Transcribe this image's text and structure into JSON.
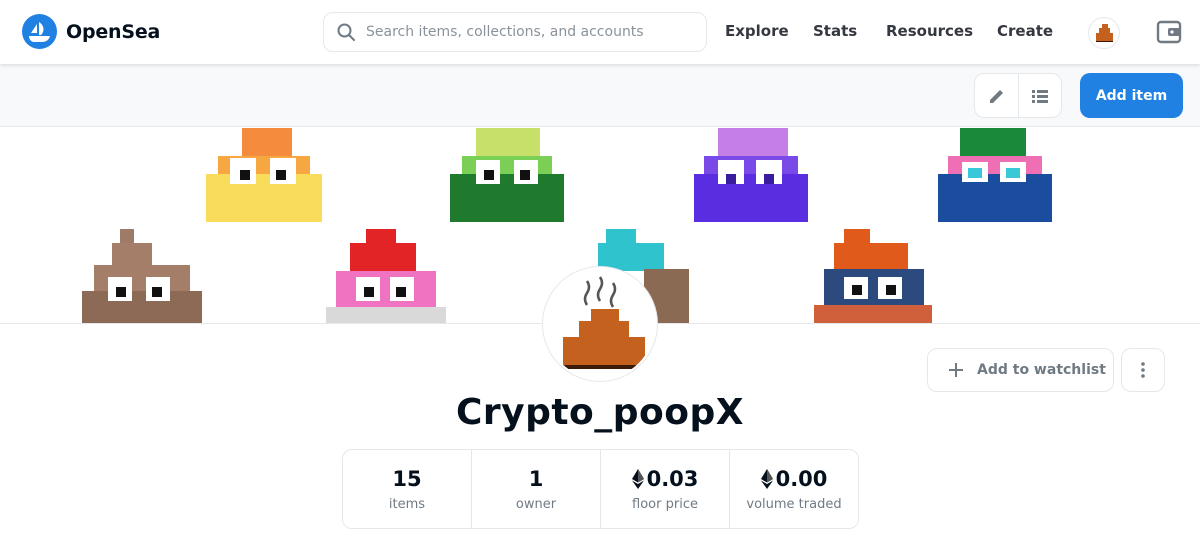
{
  "nav": {
    "brand": "OpenSea",
    "search_placeholder": "Search items, collections, and accounts",
    "links": [
      "Explore",
      "Stats",
      "Resources",
      "Create"
    ]
  },
  "toolbar": {
    "add_item_label": "Add item"
  },
  "collection": {
    "name": "Crypto_poopX",
    "watchlist_label": "Add to watchlist",
    "stats": [
      {
        "value": "15",
        "label": "items",
        "eth": false
      },
      {
        "value": "1",
        "label": "owner",
        "eth": false
      },
      {
        "value": "0.03",
        "label": "floor price",
        "eth": true
      },
      {
        "value": "0.00",
        "label": "volume traded",
        "eth": true
      }
    ]
  },
  "colors": {
    "accent": "#2081e2",
    "text_primary": "#04111d",
    "text_secondary": "#707a83",
    "border": "#e5e8eb"
  },
  "icons": [
    "opensea-logo-icon",
    "search-icon",
    "wallet-icon",
    "pencil-icon",
    "list-icon",
    "plus-icon",
    "more-vertical-icon",
    "ethereum-icon"
  ]
}
